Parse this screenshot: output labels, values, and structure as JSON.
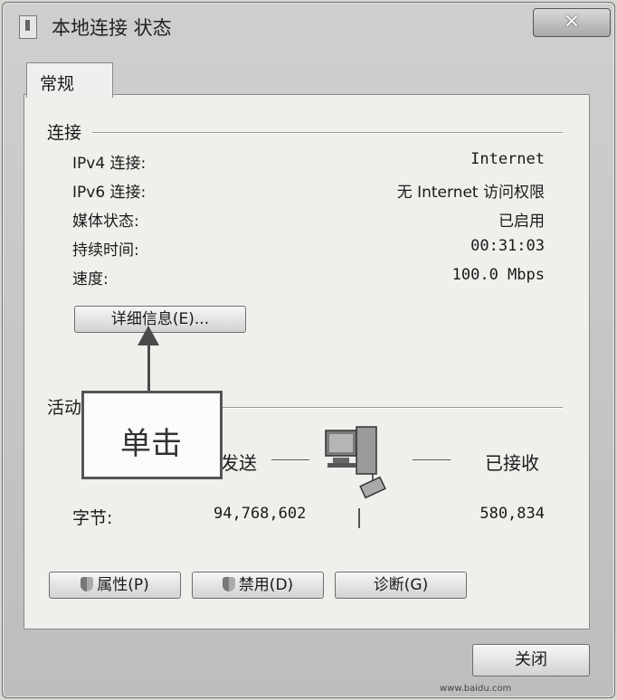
{
  "window": {
    "title": "本地连接 状态",
    "close_label": "×"
  },
  "tabs": [
    {
      "label": "常规"
    }
  ],
  "connection": {
    "group_title": "连接",
    "rows": [
      {
        "label": "IPv4 连接:",
        "value": "Internet"
      },
      {
        "label": "IPv6 连接:",
        "value": "无 Internet 访问权限"
      },
      {
        "label": "媒体状态:",
        "value": "已启用"
      },
      {
        "label": "持续时间:",
        "value": "00:31:03"
      },
      {
        "label": "速度:",
        "value": "100.0 Mbps"
      }
    ],
    "details_button": "详细信息(E)..."
  },
  "activity": {
    "group_title": "活动",
    "sent_label": "发送",
    "received_label": "已接收",
    "bytes_label": "字节:",
    "bytes_sent": "94,768,602",
    "bytes_received": "580,834"
  },
  "buttons": {
    "properties": "属性(P)",
    "disable": "禁用(D)",
    "diagnose": "诊断(G)",
    "close": "关闭"
  },
  "annotation": {
    "text": "单击"
  },
  "icons": {
    "window_icon": "network-adapter-icon",
    "shield": "uac-shield-icon",
    "computer": "network-computer-icon"
  },
  "watermark": "www.baidu.com"
}
